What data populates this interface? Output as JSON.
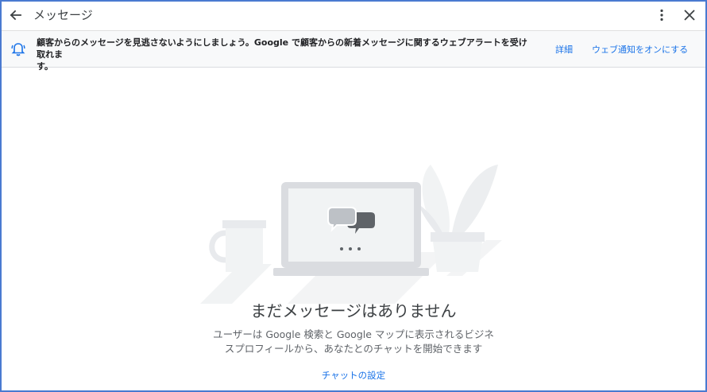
{
  "header": {
    "title": "メッセージ",
    "back_icon": "arrow-back-icon",
    "more_icon": "more-vert-icon",
    "close_icon": "close-icon"
  },
  "banner": {
    "icon": "bell-icon",
    "line1": "顧客からのメッセージを見逃さないようにしましょう。Google で顧客からの新着メッセージに関するウェブアラートを受け取れま",
    "line2": "す。",
    "details_label": "詳細",
    "enable_label": "ウェブ通知をオンにする"
  },
  "empty_state": {
    "title": "まだメッセージはありません",
    "desc_line1": "ユーザーは Google 検索と Google マップに表示されるビジネ",
    "desc_line2": "スプロフィールから、あなたとのチャットを開始できます",
    "settings_link": "チャットの設定"
  },
  "colors": {
    "accent": "#1a73e8",
    "border": "#4a7ad0",
    "banner_bg": "#f8f9fa"
  }
}
